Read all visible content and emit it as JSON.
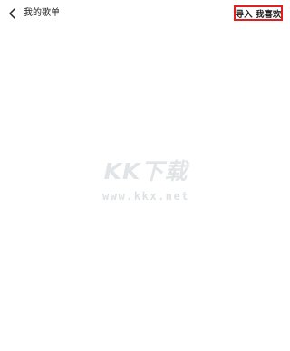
{
  "header": {
    "back_icon": "chevron-left-icon",
    "title": "我的歌单",
    "import_label": "导入 我喜欢",
    "import_border_color": "#e02020"
  },
  "watermark": {
    "logo_text": "KK下载",
    "url_text": "www.kkx.net"
  }
}
